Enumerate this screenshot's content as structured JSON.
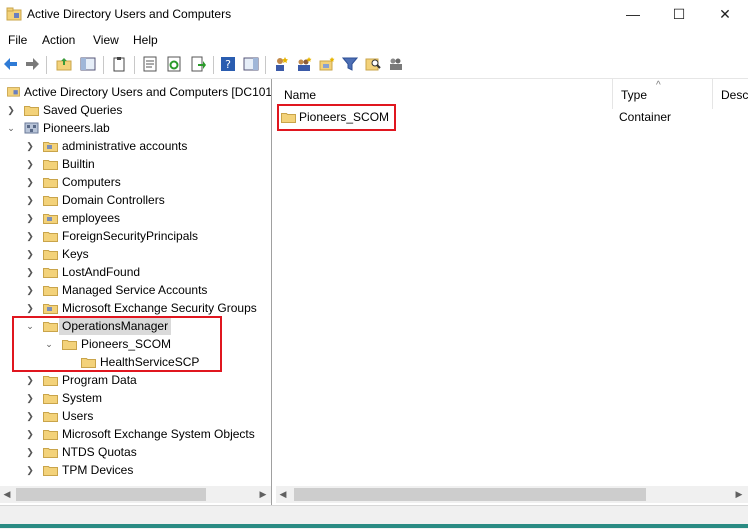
{
  "window": {
    "title": "Active Directory Users and Computers",
    "controls": {
      "minimize": "—",
      "maximize": "☐",
      "close": "✕"
    }
  },
  "menu": [
    "File",
    "Action",
    "View",
    "Help"
  ],
  "tree": {
    "root_label": "Active Directory Users and Computers [DC101.l",
    "saved_queries": "Saved Queries",
    "domain": "Pioneers.lab",
    "items": [
      "administrative accounts",
      "Builtin",
      "Computers",
      "Domain Controllers",
      "employees",
      "ForeignSecurityPrincipals",
      "Keys",
      "LostAndFound",
      "Managed Service Accounts",
      "Microsoft Exchange Security Groups"
    ],
    "selected": "OperationsManager",
    "child": "Pioneers_SCOM",
    "grandchild": "HealthServiceSCP",
    "items_after": [
      "Program Data",
      "System",
      "Users",
      "Microsoft Exchange System Objects",
      "NTDS Quotas",
      "TPM Devices"
    ]
  },
  "list": {
    "columns": [
      "Name",
      "Type",
      "Descr"
    ],
    "rows": [
      {
        "name": "Pioneers_SCOM",
        "type": "Container"
      }
    ]
  },
  "colors": {
    "accent_red": "#e0161f",
    "folder_yellow": "#f3d27a",
    "folder_edge": "#c9a44a",
    "status_teal": "#2a8b83"
  }
}
